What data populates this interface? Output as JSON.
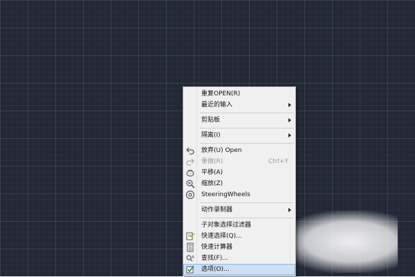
{
  "menu": {
    "items": [
      {
        "label": "重复OPEN(R)"
      },
      {
        "label": "最近的输入",
        "submenu": true
      },
      {
        "label": "剪贴板",
        "submenu": true
      },
      {
        "label": "隔离(I)",
        "submenu": true
      },
      {
        "label": "放弃(U) Open",
        "icon": "undo-icon"
      },
      {
        "label": "重做(R)",
        "shortcut": "Ctrl+Y",
        "disabled": true,
        "icon": "redo-icon"
      },
      {
        "label": "平移(A)",
        "icon": "pan-icon"
      },
      {
        "label": "缩放(Z)",
        "icon": "zoom-icon"
      },
      {
        "label": "SteeringWheels",
        "icon": "steering-wheels-icon"
      },
      {
        "label": "动作录制器",
        "submenu": true
      },
      {
        "label": "子对象选择过滤器"
      },
      {
        "label": "快速选择(Q)...",
        "icon": "quick-select-icon"
      },
      {
        "label": "快速计算器",
        "icon": "calculator-icon"
      },
      {
        "label": "查找(F)...",
        "icon": "find-icon"
      },
      {
        "label": "选项(O)...",
        "icon": "options-icon",
        "selected": true
      }
    ]
  },
  "colors": {
    "canvas_bg": "#232837",
    "menu_bg": "#f0f0f0",
    "selected_bg": "#cfe0f5"
  }
}
